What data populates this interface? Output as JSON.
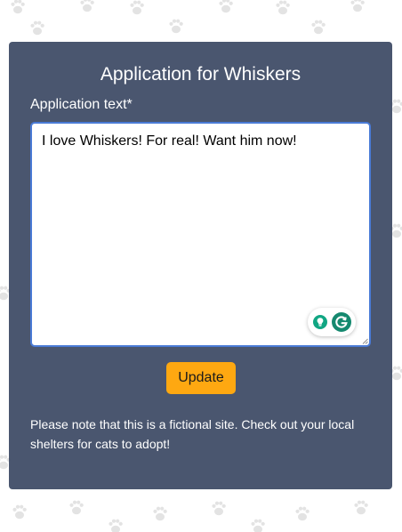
{
  "page": {
    "title": "Application for Whiskers"
  },
  "form": {
    "label": "Application text*",
    "textarea_value": "I love Whiskers! For real! Want him now!",
    "submit_label": "Update"
  },
  "footer": {
    "note": "Please note that this is a fictional site. Check out your local shelters for cats to adopt!"
  },
  "icons": {
    "background": "paw-print-pattern",
    "extension_hint": "lightbulb-icon",
    "extension_logo": "grammarly-icon"
  },
  "colors": {
    "card_bg": "#3b4863",
    "button_bg": "#fea811",
    "textarea_border": "#4a7bd6",
    "paw_print": "#e6e6e6",
    "extension_green": "#15896f"
  }
}
